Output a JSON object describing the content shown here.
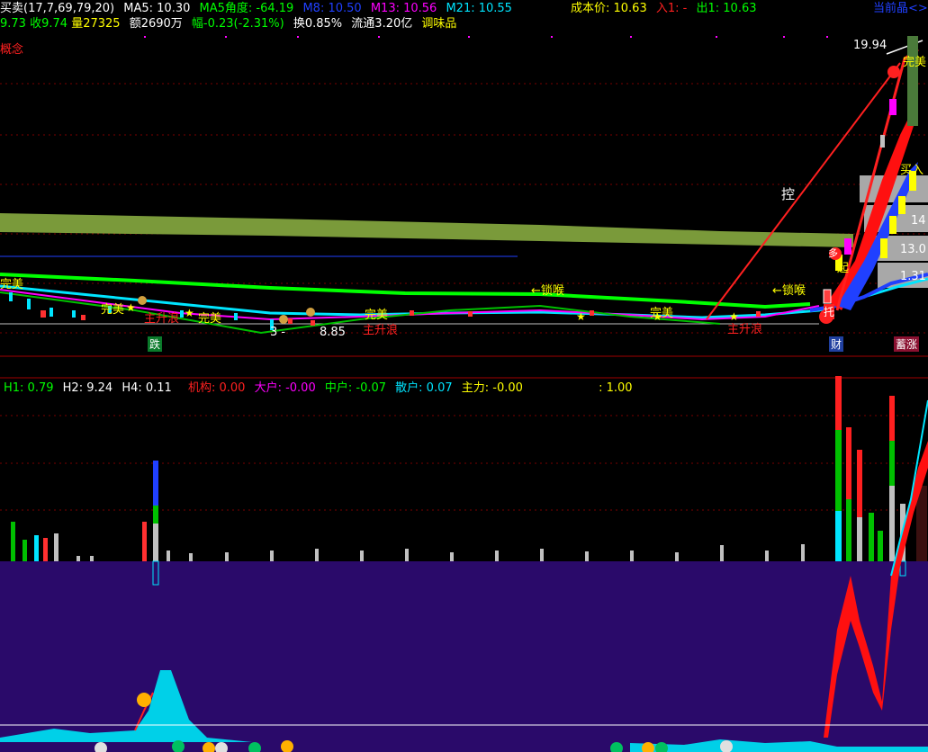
{
  "header": {
    "line1": {
      "indicator_name": "买卖(17,7,69,79,20)",
      "ma5": "MA5: 10.30",
      "ma5_angle": "MA5角度: -64.19",
      "m8": "M8: 10.50",
      "m13": "M13: 10.56",
      "m21": "M21: 10.55",
      "cost": "成本价: 10.63",
      "in": "入1: -",
      "out": "出1: 10.63",
      "current": "当前晶<>"
    },
    "line2": {
      "open": "9.73",
      "close": "收9.74",
      "volume": "量27325",
      "amount": "额2690万",
      "change": "幅-0.23(-2.31%)",
      "turnover": "换0.85%",
      "float": "流通3.20亿",
      "concept": "调味品"
    },
    "line3": {
      "concept_label": "概念"
    }
  },
  "price_labels": {
    "high": "19.94",
    "low_point": "8.85",
    "low_prefix": "3 -",
    "p13": "13.0",
    "p1131": "1.31",
    "p14": "14",
    "wanmei": "完美",
    "kong": "控",
    "suo_hou": "←锁喉",
    "suo_hou2": "←锁喉",
    "zhu_sheng": "主升浪",
    "zhu_sheng2": "主升浪",
    "zhu_sheng3": "主升浪",
    "die": "跌",
    "cai": "财",
    "zhang": "蓄涨",
    "tuo": "托",
    "qi": "起",
    "duo": "多",
    "buy_in": "买入",
    "wanmei_list": [
      "完美",
      "完美",
      "完美",
      "完美",
      "完美"
    ]
  },
  "indicator_header": {
    "h1": "H1: 0.79",
    "h2": "H2: 9.24",
    "h4": "H4: 0.11",
    "institution": "机构: 0.00",
    "big": "大户: -0.00",
    "mid": "中户: -0.07",
    "retail": "散户: 0.07",
    "main": "主力: -0.00",
    "ratio": ": 1.00"
  },
  "colors": {
    "red": "#ff2020",
    "green": "#00ff00",
    "yellow": "#ffff00",
    "cyan": "#00e5ff",
    "magenta": "#ff00ff",
    "blue": "#2040ff",
    "olive": "#7a9a3a",
    "indigo": "#2a0a6a",
    "gray": "#c0c0c0"
  }
}
